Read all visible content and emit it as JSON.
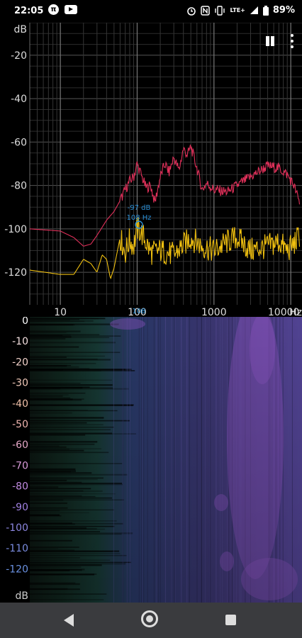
{
  "status_bar": {
    "time": "22:05",
    "left_icons": [
      "pi-icon",
      "youtube-icon"
    ],
    "network": "LTE+",
    "battery": "89%"
  },
  "toolbar": {
    "icons": [
      "pause-icon",
      "more-vert-icon"
    ]
  },
  "spectrum": {
    "y_unit": "dB",
    "y_ticks": [
      "-20",
      "-40",
      "-60",
      "-80",
      "-100",
      "-120"
    ],
    "x_ticks": [
      "10",
      "100",
      "1000",
      "10000"
    ],
    "x_unit": "Hz",
    "cursor": {
      "db_label": "-97 dB",
      "hz_label": "108 Hz",
      "axis_marker": "108"
    },
    "colors": {
      "background": "#000000",
      "grid": "#3a3a3a",
      "peak": "#e0305a",
      "live": "#f0c010",
      "cursor": "#2a8fd6",
      "text": "#dddddd"
    }
  },
  "chart_data": {
    "type": "line",
    "x_scale": "log",
    "xlim": [
      4,
      14000
    ],
    "ylim": [
      -135,
      -5
    ],
    "xlabel": "Hz",
    "ylabel": "dB",
    "series": [
      {
        "color": "#e0305a",
        "x": [
          4,
          10,
          15,
          20,
          25,
          30,
          40,
          50,
          60,
          70,
          80,
          90,
          100,
          110,
          130,
          150,
          170,
          200,
          230,
          260,
          300,
          350,
          400,
          450,
          500,
          600,
          700,
          800,
          1000,
          1500,
          2000,
          3000,
          5000,
          7000,
          9000,
          11000,
          13000
        ],
        "y": [
          -100,
          -101,
          -104,
          -108,
          -107,
          -103,
          -96,
          -92,
          -87,
          -82,
          -78,
          -76,
          -70,
          -74,
          -81,
          -80,
          -88,
          -76,
          -70,
          -74,
          -67,
          -73,
          -63,
          -66,
          -62,
          -72,
          -82,
          -79,
          -82,
          -83,
          -80,
          -76,
          -71,
          -72,
          -75,
          -80,
          -88
        ]
      },
      {
        "color": "#f0c010",
        "x": [
          4,
          10,
          15,
          20,
          25,
          30,
          35,
          40,
          45,
          50,
          60,
          70,
          80,
          90,
          100,
          110,
          130,
          150,
          200,
          300,
          500,
          700,
          1000,
          1500,
          2000,
          3000,
          5000,
          7000,
          9000,
          11000,
          13000
        ],
        "y": [
          -119,
          -121,
          -121,
          -114,
          -116,
          -120,
          -112,
          -114,
          -123,
          -118,
          -104,
          -111,
          -105,
          -108,
          -100,
          -101,
          -106,
          -111,
          -110,
          -112,
          -104,
          -108,
          -110,
          -106,
          -104,
          -110,
          -108,
          -106,
          -110,
          -107,
          -103
        ]
      }
    ]
  },
  "spectrogram": {
    "y_ticks": [
      "0",
      "-10",
      "-20",
      "-30",
      "-40",
      "-50",
      "-60",
      "-70",
      "-80",
      "-90",
      "-100",
      "-110",
      "-120"
    ],
    "y_unit": "dB",
    "tick_colors": [
      "#ffffff",
      "#f5e0e0",
      "#f0d0c8",
      "#f0c8b8",
      "#f0bfa8",
      "#f0b5b0",
      "#e6a8c8",
      "#d89ad8",
      "#c08ae0",
      "#a080e0",
      "#8c86e0",
      "#7a8ce0",
      "#6a90e0"
    ]
  },
  "nav_bar": {
    "buttons": [
      "back-icon",
      "home-icon",
      "recents-icon"
    ]
  }
}
